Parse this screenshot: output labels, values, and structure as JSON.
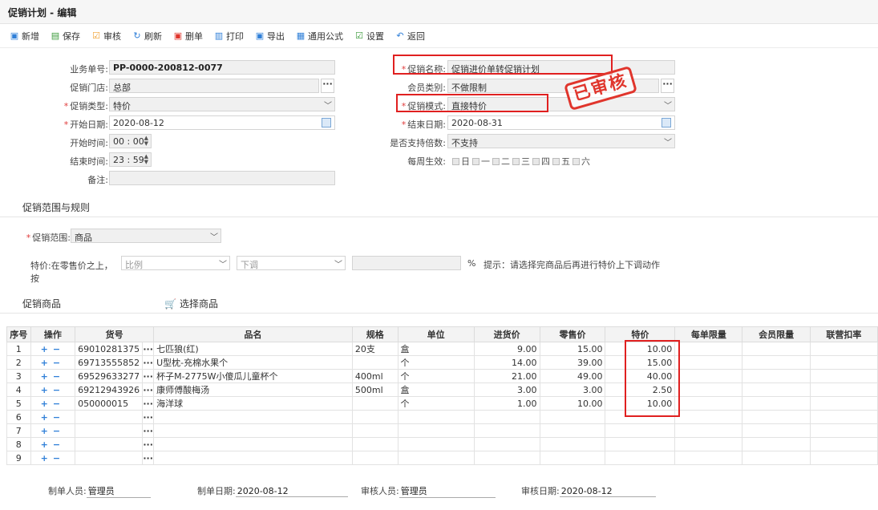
{
  "window": {
    "title": "促销计划 - 编辑"
  },
  "toolbar": [
    {
      "label": "新增",
      "icon": "new-doc-icon",
      "color": "#2f7fd8"
    },
    {
      "label": "保存",
      "icon": "save-icon",
      "color": "#3a9a3a"
    },
    {
      "label": "审核",
      "icon": "audit-icon",
      "color": "#f0a030"
    },
    {
      "label": "刷新",
      "icon": "refresh-icon",
      "color": "#2f7fd8"
    },
    {
      "label": "删单",
      "icon": "delete-doc-icon",
      "color": "#e0352c"
    },
    {
      "label": "打印",
      "icon": "print-icon",
      "color": "#2f7fd8"
    },
    {
      "label": "导出",
      "icon": "export-icon",
      "color": "#2f7fd8"
    },
    {
      "label": "通用公式",
      "icon": "formula-icon",
      "color": "#2f7fd8"
    },
    {
      "label": "设置",
      "icon": "settings-icon",
      "color": "#3a9a3a"
    },
    {
      "label": "返回",
      "icon": "back-icon",
      "color": "#2f7fd8"
    }
  ],
  "form": {
    "doc_no_label": "业务单号:",
    "doc_no": "PP-0000-200812-0077",
    "store_label": "促销门店:",
    "store": "总部",
    "type_label": "促销类型:",
    "type": "特价",
    "start_date_label": "开始日期:",
    "start_date": "2020-08-12",
    "start_time_label": "开始时间:",
    "start_time": "00 : 00",
    "end_time_label": "结束时间:",
    "end_time": "23 : 59",
    "remark_label": "备注:",
    "remark": "",
    "name_label": "促销名称:",
    "name": "促销进价单转促销计划",
    "member_label": "会员类别:",
    "member": "不做限制",
    "mode_label": "促销模式:",
    "mode": "直接特价",
    "end_date_label": "结束日期:",
    "end_date": "2020-08-31",
    "multi_label": "是否支持倍数:",
    "multi": "不支持",
    "weekly_label": "每周生效:",
    "weekdays": [
      "日",
      "一",
      "二",
      "三",
      "四",
      "五",
      "六"
    ]
  },
  "stamp": "已审核",
  "rules": {
    "section_title": "促销范围与规则",
    "scope_label": "促销范围:",
    "scope": "商品",
    "price_rule_label": "特价:在零售价之上，按",
    "basis": "比例",
    "direction": "下调",
    "value": "",
    "percent": "%",
    "hint": "提示：请选择完商品后再进行特价上下调动作"
  },
  "products": {
    "section_title": "促销商品",
    "select_label": "选择商品",
    "columns": [
      "序号",
      "操作",
      "货号",
      "品名",
      "规格",
      "单位",
      "进货价",
      "零售价",
      "特价",
      "每单限量",
      "会员限量",
      "联营扣率"
    ],
    "rows": [
      {
        "no": "1",
        "code": "69010281375",
        "name": "七匹狼(红)",
        "spec": "20支",
        "unit": "盒",
        "cost": "9.00",
        "retail": "15.00",
        "special": "10.00"
      },
      {
        "no": "2",
        "code": "69713555852",
        "name": "U型枕-充棉水果个",
        "spec": "",
        "unit": "个",
        "cost": "14.00",
        "retail": "39.00",
        "special": "15.00"
      },
      {
        "no": "3",
        "code": "69529633277",
        "name": "杯子M-2775W小傻瓜儿童杯个",
        "spec": "400ml",
        "unit": "个",
        "cost": "21.00",
        "retail": "49.00",
        "special": "40.00"
      },
      {
        "no": "4",
        "code": "69212943926",
        "name": "康师傅酸梅汤",
        "spec": "500ml",
        "unit": "盒",
        "cost": "3.00",
        "retail": "3.00",
        "special": "2.50"
      },
      {
        "no": "5",
        "code": "050000015",
        "name": "海洋球",
        "spec": "",
        "unit": "个",
        "cost": "1.00",
        "retail": "10.00",
        "special": "10.00"
      },
      {
        "no": "6",
        "code": "",
        "name": "",
        "spec": "",
        "unit": "",
        "cost": "",
        "retail": "",
        "special": ""
      },
      {
        "no": "7",
        "code": "",
        "name": "",
        "spec": "",
        "unit": "",
        "cost": "",
        "retail": "",
        "special": ""
      },
      {
        "no": "8",
        "code": "",
        "name": "",
        "spec": "",
        "unit": "",
        "cost": "",
        "retail": "",
        "special": ""
      },
      {
        "no": "9",
        "code": "",
        "name": "",
        "spec": "",
        "unit": "",
        "cost": "",
        "retail": "",
        "special": ""
      }
    ]
  },
  "footer": {
    "creator_label": "制单人员:",
    "creator": "管理员",
    "create_date_label": "制单日期:",
    "create_date": "2020-08-12",
    "auditor_label": "审核人员:",
    "auditor": "管理员",
    "audit_date_label": "审核日期:",
    "audit_date": "2020-08-12"
  }
}
